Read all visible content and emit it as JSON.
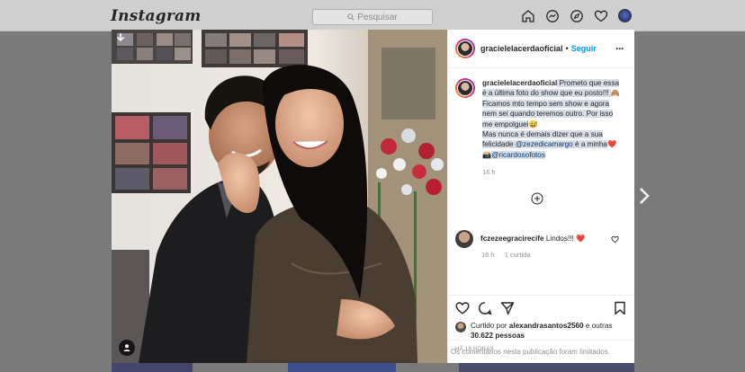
{
  "topbar": {
    "logo": "Instagram",
    "search_placeholder": "Pesquisar",
    "icons": [
      "home-icon",
      "messenger-icon",
      "explore-icon",
      "heart-icon",
      "profile-avatar"
    ]
  },
  "post": {
    "username": "gracielelacerdaoficial",
    "separator": "•",
    "follow_label": "Seguir",
    "more_label": "···",
    "caption": {
      "username": "gracielelacerdaoficial",
      "line1": " Prometo que essa é a última foto do show que eu posto!!! ",
      "emoji1": "🙈",
      "line2": "Ficamos mto tempo sem show e agora nem sei quando teremos outro. Por isso me empolguei",
      "emoji2": "😅",
      "line3": "Mas nunca é demais dizer que a sua felicidade ",
      "mention1": "@zezedicamargo",
      "line4": " é a minha",
      "emoji3": "❤️📸",
      "mention2": "@ricardosofotos",
      "time": "16 h"
    },
    "comment": {
      "username": "fczezeegracirecife",
      "text": " Lindos!!! ",
      "emoji": "❤️",
      "time": "16 h",
      "likes": "1 curtida"
    },
    "likes": {
      "prefix": "Curtido por ",
      "user": "alexandrasantos2560",
      "middle": " e outras ",
      "count": "30.622 pessoas"
    },
    "post_time": "HÁ 16 HORAS",
    "limited_notice": "Os comentários nesta publicação foram limitados."
  },
  "colors": {
    "accent": "#0095f6",
    "heart": "#ed4956",
    "text": "#262626",
    "muted": "#8e8e8e"
  }
}
